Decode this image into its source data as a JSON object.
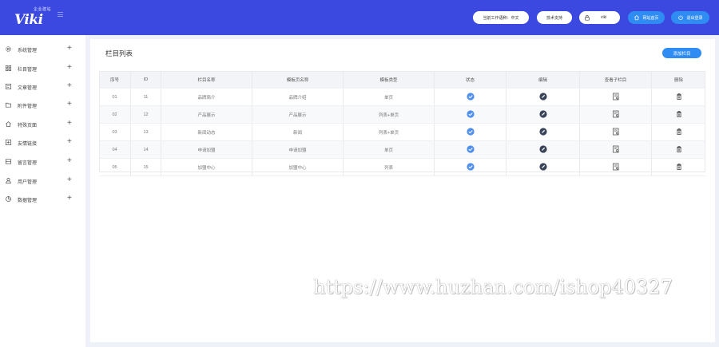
{
  "header": {
    "logo_text": "Viki",
    "logo_small": "企业建站",
    "buttons": [
      {
        "label": "当前工作语种：中文",
        "icon": "",
        "style": "white"
      },
      {
        "label": "技术支持",
        "icon": "",
        "style": "white"
      },
      {
        "label": "viki",
        "icon": "lock-icon",
        "style": "white"
      },
      {
        "label": "网站首页",
        "icon": "home-icon",
        "style": "blue"
      },
      {
        "label": "退出登录",
        "icon": "power-icon",
        "style": "blue"
      }
    ]
  },
  "sidebar": {
    "items": [
      {
        "label": "系统管理",
        "icon": "gear-icon"
      },
      {
        "label": "栏目管理",
        "icon": "grid-icon"
      },
      {
        "label": "文章管理",
        "icon": "article-icon"
      },
      {
        "label": "附件管理",
        "icon": "folder-icon"
      },
      {
        "label": "特殊页面",
        "icon": "home-icon"
      },
      {
        "label": "友情链接",
        "icon": "link-icon"
      },
      {
        "label": "留言管理",
        "icon": "message-icon"
      },
      {
        "label": "用户管理",
        "icon": "user-icon"
      },
      {
        "label": "数据管理",
        "icon": "pie-chart-icon"
      }
    ]
  },
  "main": {
    "title": "栏目列表",
    "add_button": "添加栏目",
    "columns": [
      "序号",
      "ID",
      "栏目名称",
      "模板页名称",
      "模板类型",
      "状态",
      "编辑",
      "查看子栏目",
      "删除"
    ],
    "rows": [
      [
        "01",
        "11",
        "品牌简介",
        "品牌介绍",
        "单页"
      ],
      [
        "02",
        "12",
        "产品展示",
        "产品展示",
        "列表+单页"
      ],
      [
        "03",
        "13",
        "新闻动态",
        "新闻",
        "列表+单页"
      ],
      [
        "04",
        "14",
        "申请加盟",
        "申请加盟",
        "单页"
      ],
      [
        "05",
        "15",
        "加盟中心",
        "加盟中心",
        "列表"
      ]
    ]
  },
  "watermark": "https://www.huzhan.com/ishop40327",
  "colors": {
    "header": "#3b49e0",
    "accent": "#2f8cf3",
    "status": "#4f8ff0",
    "edit": "#3a4458"
  }
}
